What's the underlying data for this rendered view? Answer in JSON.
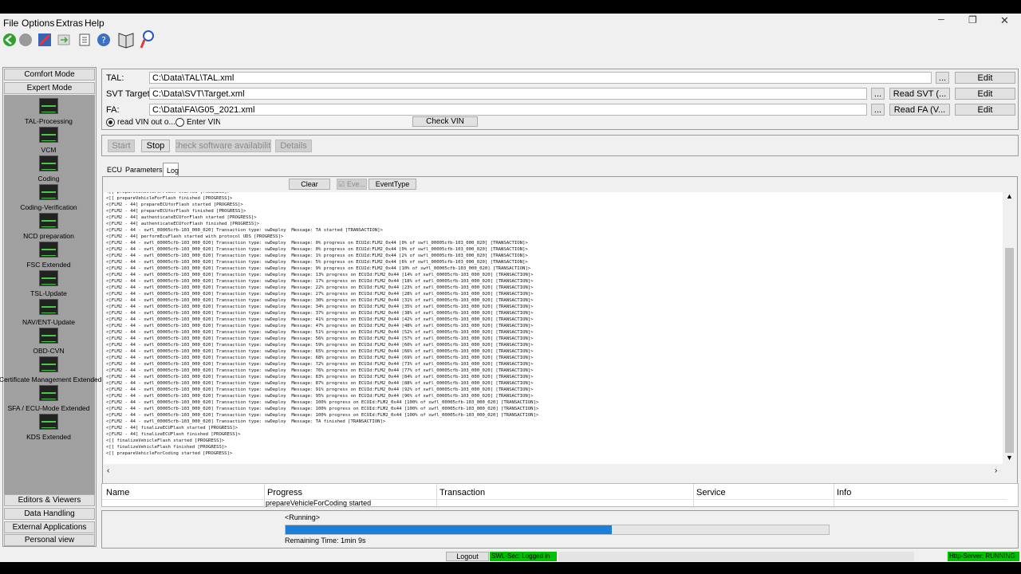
{
  "window": {
    "minimize": "─",
    "restore": "❐",
    "close": "✕"
  },
  "menu": [
    "File",
    "Options",
    "Extras",
    "Help"
  ],
  "toolbar": [
    "back-icon",
    "stop-icon",
    "tools-icon",
    "forward-icon",
    "document-icon",
    "help-icon",
    "book-icon",
    "magnifier-icon"
  ],
  "sidebar": {
    "comfort_mode": "Comfort Mode",
    "expert_mode": "Expert Mode",
    "items": [
      "TAL-Processing",
      "VCM",
      "Coding",
      "Coding-Verification",
      "NCD preparation",
      "FSC Extended",
      "TSL-Update",
      "NAV/ENT-Update",
      "OBD-CVN",
      "Certificate Management Extended",
      "SFA / ECU-Mode Extended",
      "KDS Extended"
    ],
    "bottom": [
      "Editors & Viewers",
      "Data Handling",
      "External Applications",
      "Personal view"
    ]
  },
  "files": {
    "tal_label": "TAL:",
    "tal_value": "C:\\Data\\TAL\\TAL.xml",
    "svt_label": "SVT Target",
    "svt_value": "C:\\Data\\SVT\\Target.xml",
    "fa_label": "FA:",
    "fa_value": "C:\\Data\\FA\\G05_2021.xml",
    "browse": "...",
    "edit": "Edit",
    "read_svt": "Read SVT (...",
    "read_fa": "Read FA (V...",
    "radio_read_vin": "read VIN out o...",
    "radio_enter_vin": "Enter VIN:",
    "check_vin": "Check VIN"
  },
  "actions": {
    "start": "Start",
    "stop": "Stop",
    "check_sw": "Check software availability",
    "details": "Details"
  },
  "tabs": [
    "ECU",
    "Parameters",
    "Log"
  ],
  "log_toolbar": {
    "clear": "Clear",
    "events": "Eve...",
    "event_type": "EventType"
  },
  "log_lines": [
    "<[] prepareVehicleForFlash started [PROGRESS]>",
    "<[] prepareVehicleForFlash finished [PROGRESS]>",
    "<[FLM2 - 44] prepareECUforFlash started [PROGRESS]>",
    "<[FLM2 - 44] prepareECUforFlash finished [PROGRESS]>",
    "<[FLM2 - 44] authenticateECUforFlash started [PROGRESS]>",
    "<[FLM2 - 44] authenticateECUforFlash finished [PROGRESS]>",
    "<[FLM2 - 44 - swfl_00005cfb-103_000_020] Transaction type: swDeploy  Message: TA started [TRANSACTION]>",
    "<[FLM2 - 44] performEcuFlash started with protocol UDS [PROGRESS]>",
    "<[FLM2 - 44 - swfl_00005cfb-103_000_020] Transaction type: swDeploy  Message: 0% progress on ECUId:FLM2_0x44 [0% of swfl_00005cfb-103_000_020] [TRANSACTION]>",
    "<[FLM2 - 44 - swfl_00005cfb-103_000_020] Transaction type: swDeploy  Message: 0% progress on ECUId:FLM2_0x44 [0% of swfl_00005cfb-103_000_020] [TRANSACTION]>",
    "<[FLM2 - 44 - swfl_00005cfb-103_000_020] Transaction type: swDeploy  Message: 1% progress on ECUId:FLM2_0x44 [2% of swfl_00005cfb-103_000_020] [TRANSACTION]>",
    "<[FLM2 - 44 - swfl_00005cfb-103_000_020] Transaction type: swDeploy  Message: 5% progress on ECUId:FLM2_0x44 [6% of swfl_00005cfb-103_000_020] [TRANSACTION]>",
    "<[FLM2 - 44 - swfl_00005cfb-103_000_020] Transaction type: swDeploy  Message: 9% progress on ECUId:FLM2_0x44 [10% of swfl_00005cfb-103_000_020] [TRANSACTION]>",
    "<[FLM2 - 44 - swfl_00005cfb-103_000_020] Transaction type: swDeploy  Message: 13% progress on ECUId:FLM2_0x44 [14% of swfl_00005cfb-103_000_020] [TRANSACTION]>",
    "<[FLM2 - 44 - swfl_00005cfb-103_000_020] Transaction type: swDeploy  Message: 17% progress on ECUId:FLM2_0x44 [18% of swfl_00005cfb-103_000_020] [TRANSACTION]>",
    "<[FLM2 - 44 - swfl_00005cfb-103_000_020] Transaction type: swDeploy  Message: 22% progress on ECUId:FLM2_0x44 [23% of swfl_00005cfb-103_000_020] [TRANSACTION]>",
    "<[FLM2 - 44 - swfl_00005cfb-103_000_020] Transaction type: swDeploy  Message: 27% progress on ECUId:FLM2_0x44 [28% of swfl_00005cfb-103_000_020] [TRANSACTION]>",
    "<[FLM2 - 44 - swfl_00005cfb-103_000_020] Transaction type: swDeploy  Message: 30% progress on ECUId:FLM2_0x44 [31% of swfl_00005cfb-103_000_020] [TRANSACTION]>",
    "<[FLM2 - 44 - swfl_00005cfb-103_000_020] Transaction type: swDeploy  Message: 34% progress on ECUId:FLM2_0x44 [35% of swfl_00005cfb-103_000_020] [TRANSACTION]>",
    "<[FLM2 - 44 - swfl_00005cfb-103_000_020] Transaction type: swDeploy  Message: 37% progress on ECUId:FLM2_0x44 [38% of swfl_00005cfb-103_000_020] [TRANSACTION]>",
    "<[FLM2 - 44 - swfl_00005cfb-103_000_020] Transaction type: swDeploy  Message: 41% progress on ECUId:FLM2_0x44 [42% of swfl_00005cfb-103_000_020] [TRANSACTION]>",
    "<[FLM2 - 44 - swfl_00005cfb-103_000_020] Transaction type: swDeploy  Message: 47% progress on ECUId:FLM2_0x44 [48% of swfl_00005cfb-103_000_020] [TRANSACTION]>",
    "<[FLM2 - 44 - swfl_00005cfb-103_000_020] Transaction type: swDeploy  Message: 51% progress on ECUId:FLM2_0x44 [52% of swfl_00005cfb-103_000_020] [TRANSACTION]>",
    "<[FLM2 - 44 - swfl_00005cfb-103_000_020] Transaction type: swDeploy  Message: 56% progress on ECUId:FLM2_0x44 [57% of swfl_00005cfb-103_000_020] [TRANSACTION]>",
    "<[FLM2 - 44 - swfl_00005cfb-103_000_020] Transaction type: swDeploy  Message: 59% progress on ECUId:FLM2_0x44 [60% of swfl_00005cfb-103_000_020] [TRANSACTION]>",
    "<[FLM2 - 44 - swfl_00005cfb-103_000_020] Transaction type: swDeploy  Message: 65% progress on ECUId:FLM2_0x44 [66% of swfl_00005cfb-103_000_020] [TRANSACTION]>",
    "<[FLM2 - 44 - swfl_00005cfb-103_000_020] Transaction type: swDeploy  Message: 68% progress on ECUId:FLM2_0x44 [69% of swfl_00005cfb-103_000_020] [TRANSACTION]>",
    "<[FLM2 - 44 - swfl_00005cfb-103_000_020] Transaction type: swDeploy  Message: 72% progress on ECUId:FLM2_0x44 [73% of swfl_00005cfb-103_000_020] [TRANSACTION]>",
    "<[FLM2 - 44 - swfl_00005cfb-103_000_020] Transaction type: swDeploy  Message: 76% progress on ECUId:FLM2_0x44 [77% of swfl_00005cfb-103_000_020] [TRANSACTION]>",
    "<[FLM2 - 44 - swfl_00005cfb-103_000_020] Transaction type: swDeploy  Message: 83% progress on ECUId:FLM2_0x44 [84% of swfl_00005cfb-103_000_020] [TRANSACTION]>",
    "<[FLM2 - 44 - swfl_00005cfb-103_000_020] Transaction type: swDeploy  Message: 87% progress on ECUId:FLM2_0x44 [88% of swfl_00005cfb-103_000_020] [TRANSACTION]>",
    "<[FLM2 - 44 - swfl_00005cfb-103_000_020] Transaction type: swDeploy  Message: 91% progress on ECUId:FLM2_0x44 [92% of swfl_00005cfb-103_000_020] [TRANSACTION]>",
    "<[FLM2 - 44 - swfl_00005cfb-103_000_020] Transaction type: swDeploy  Message: 95% progress on ECUId:FLM2_0x44 [96% of swfl_00005cfb-103_000_020] [TRANSACTION]>",
    "<[FLM2 - 44 - swfl_00005cfb-103_000_020] Transaction type: swDeploy  Message: 100% progress on ECUId:FLM2_0x44 [100% of swfl_00005cfb-103_000_020] [TRANSACTION]>",
    "<[FLM2 - 44 - swfl_00005cfb-103_000_020] Transaction type: swDeploy  Message: 100% progress on ECUId:FLM2_0x44 [100% of swfl_00005cfb-103_000_020] [TRANSACTION]>",
    "<[FLM2 - 44 - swfl_00005cfb-103_000_020] Transaction type: swDeploy  Message: 100% progress on ECUId:FLM2_0x44 [100% of swfl_00005cfb-103_000_020] [TRANSACTION]>",
    "<[FLM2 - 44 - swfl_00005cfb-103_000_020] Transaction type: swDeploy  Message: TA finished [TRANSACTION]>",
    "<[FLM2 - 44] finalizeECUFlash started [PROGRESS]>",
    "<[FLM2 - 44] finalizeECUFlash finished [PROGRESS]>",
    "<[] finalizeVehicleFlash started [PROGRESS]>",
    "<[] finalizeVehicleFlash finished [PROGRESS]>",
    "<[] prepareVehicleForCoding started [PROGRESS]>"
  ],
  "table": {
    "headers": [
      "Name",
      "Progress",
      "Transaction",
      "Service",
      "Info"
    ],
    "row": {
      "name": "",
      "progress": "prepareVehicleForCoding started",
      "transaction": "",
      "service": "",
      "info": ""
    }
  },
  "status": {
    "running": "<Running>",
    "progress_fraction": 0.6,
    "remaining_label": "Remaining Time:",
    "remaining_value": "1min 9s"
  },
  "footer": {
    "logout": "Logout",
    "swl": "SWL-Sec: Logged in",
    "http": "Http-Server: RUNNING"
  },
  "colors": {
    "accent": "#1a7fd6",
    "green": "#00c000",
    "sidebar_bg": "#a0a0a0"
  }
}
